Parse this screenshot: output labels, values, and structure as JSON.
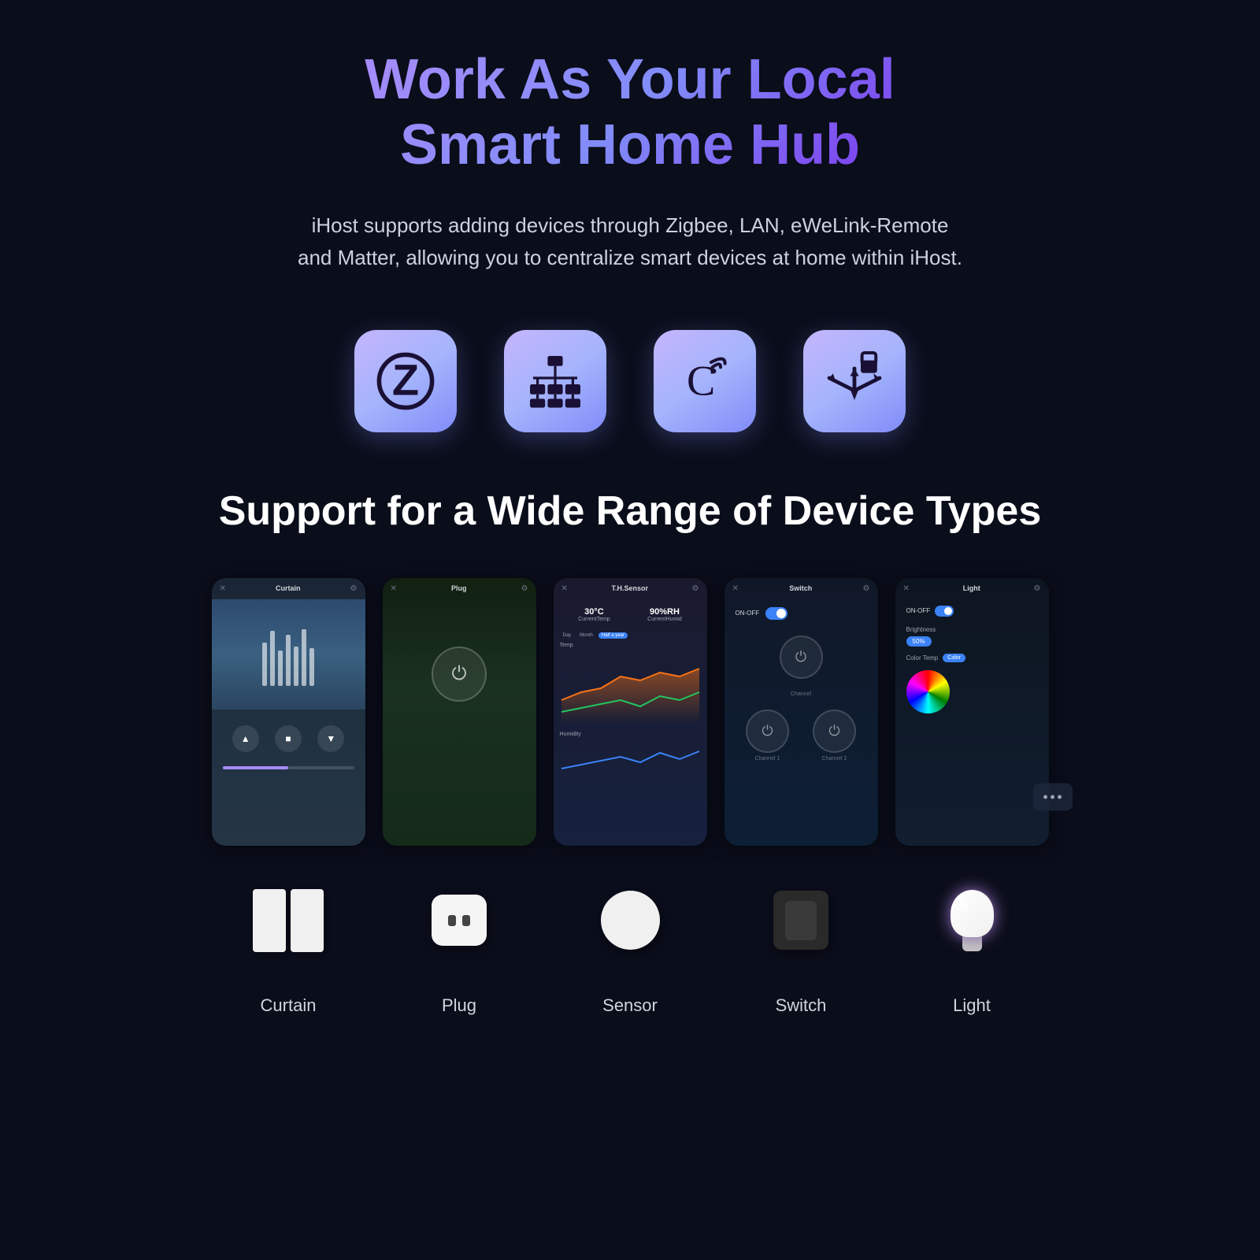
{
  "header": {
    "title_line1": "Work As Your Local",
    "title_line2": "Smart Home Hub"
  },
  "subtitle": "iHost supports adding devices through Zigbee, LAN, eWeLink-Remote and Matter, allowing you to centralize smart devices at home within iHost.",
  "protocols": [
    {
      "name": "zigbee",
      "label": "Zigbee"
    },
    {
      "name": "lan",
      "label": "LAN"
    },
    {
      "name": "ewelink",
      "label": "eWeLink"
    },
    {
      "name": "matter",
      "label": "Matter"
    }
  ],
  "section_title": "Support for a Wide Range of Device Types",
  "devices": [
    {
      "id": "curtain",
      "label": "Curtain",
      "screen_title": "Curtain"
    },
    {
      "id": "plug",
      "label": "Plug",
      "screen_title": "Plug"
    },
    {
      "id": "sensor",
      "label": "Sensor",
      "screen_title": "T.H.Sensor",
      "temp": "30°C",
      "humidity": "90%RH"
    },
    {
      "id": "switch",
      "label": "Switch",
      "screen_title": "Switch"
    },
    {
      "id": "light",
      "label": "Light",
      "screen_title": "Light",
      "brightness": "50%"
    }
  ],
  "colors": {
    "bg": "#0a0d1a",
    "accent_purple": "#a78bfa",
    "accent_blue": "#818cf8",
    "text_secondary": "#9ca3af"
  }
}
